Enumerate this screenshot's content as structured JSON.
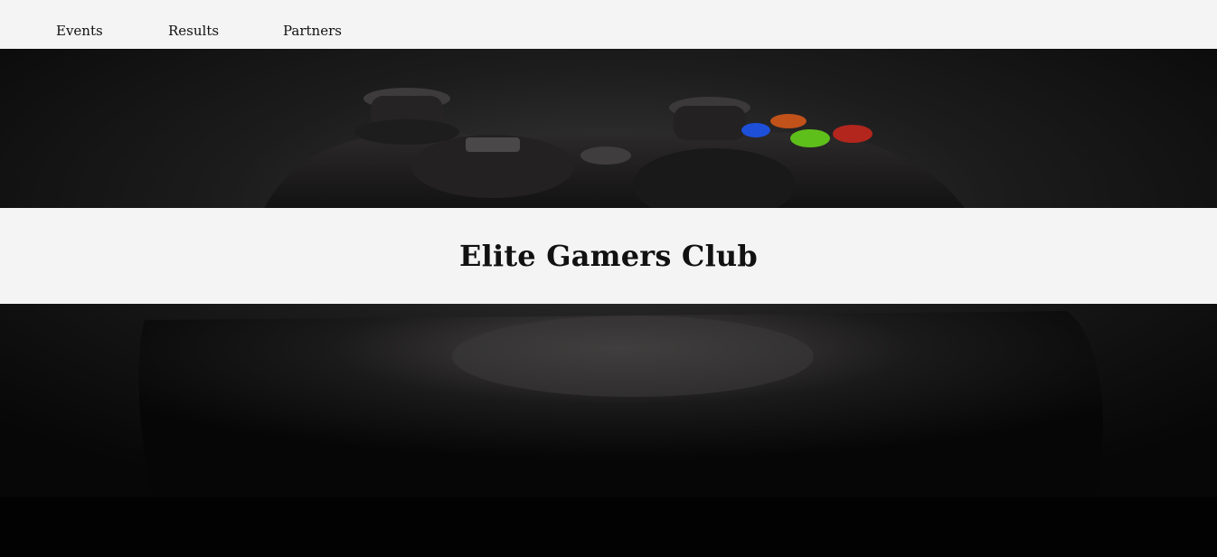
{
  "nav": {
    "items": [
      {
        "label": "Events"
      },
      {
        "label": "Results"
      },
      {
        "label": "Partners"
      }
    ]
  },
  "hero": {
    "image": "game-controller-photo",
    "title": "Elite Gamers Club"
  },
  "colors": {
    "nav_background": "#f4f4f4",
    "title_band_background": "#f4f4f4",
    "hero_background": "#0b0b0b",
    "footer_background": "#020202",
    "button_blue": "#1d4fd8",
    "button_green": "#5fbf1a",
    "button_orange": "#c0521a",
    "button_red": "#b2261e"
  }
}
